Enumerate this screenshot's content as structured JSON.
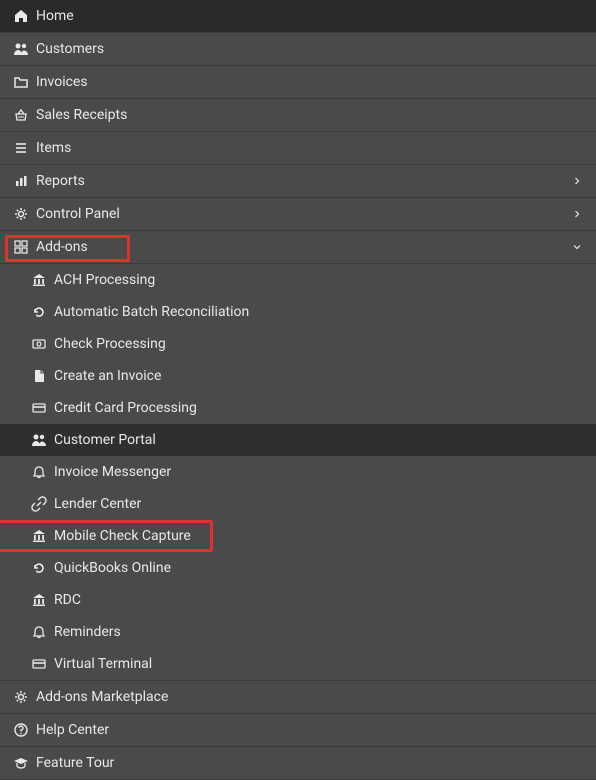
{
  "menu": [
    {
      "icon": "home",
      "label": "Home"
    },
    {
      "icon": "users",
      "label": "Customers"
    },
    {
      "icon": "folder",
      "label": "Invoices"
    },
    {
      "icon": "basket",
      "label": "Sales Receipts"
    },
    {
      "icon": "list",
      "label": "Items"
    },
    {
      "icon": "chart",
      "label": "Reports",
      "chev": "right"
    },
    {
      "icon": "gears",
      "label": "Control Panel",
      "chev": "right"
    },
    {
      "icon": "addon",
      "label": "Add-ons",
      "chev": "down",
      "highlighted": true,
      "expanded": true
    }
  ],
  "submenu": [
    {
      "icon": "bank",
      "label": "ACH Processing"
    },
    {
      "icon": "refresh",
      "label": "Automatic Batch Reconciliation"
    },
    {
      "icon": "money",
      "label": "Check Processing"
    },
    {
      "icon": "file",
      "label": "Create an Invoice"
    },
    {
      "icon": "card",
      "label": "Credit Card Processing"
    },
    {
      "icon": "users",
      "label": "Customer Portal",
      "active": true
    },
    {
      "icon": "bell",
      "label": "Invoice Messenger"
    },
    {
      "icon": "link",
      "label": "Lender Center"
    },
    {
      "icon": "bank",
      "label": "Mobile Check Capture",
      "highlighted": true
    },
    {
      "icon": "refresh",
      "label": "QuickBooks Online"
    },
    {
      "icon": "bank",
      "label": "RDC"
    },
    {
      "icon": "bell",
      "label": "Reminders"
    },
    {
      "icon": "card",
      "label": "Virtual Terminal"
    }
  ],
  "menu_after": [
    {
      "icon": "gears",
      "label": "Add-ons Marketplace"
    },
    {
      "icon": "help",
      "label": "Help Center"
    },
    {
      "icon": "grad",
      "label": "Feature Tour"
    }
  ]
}
